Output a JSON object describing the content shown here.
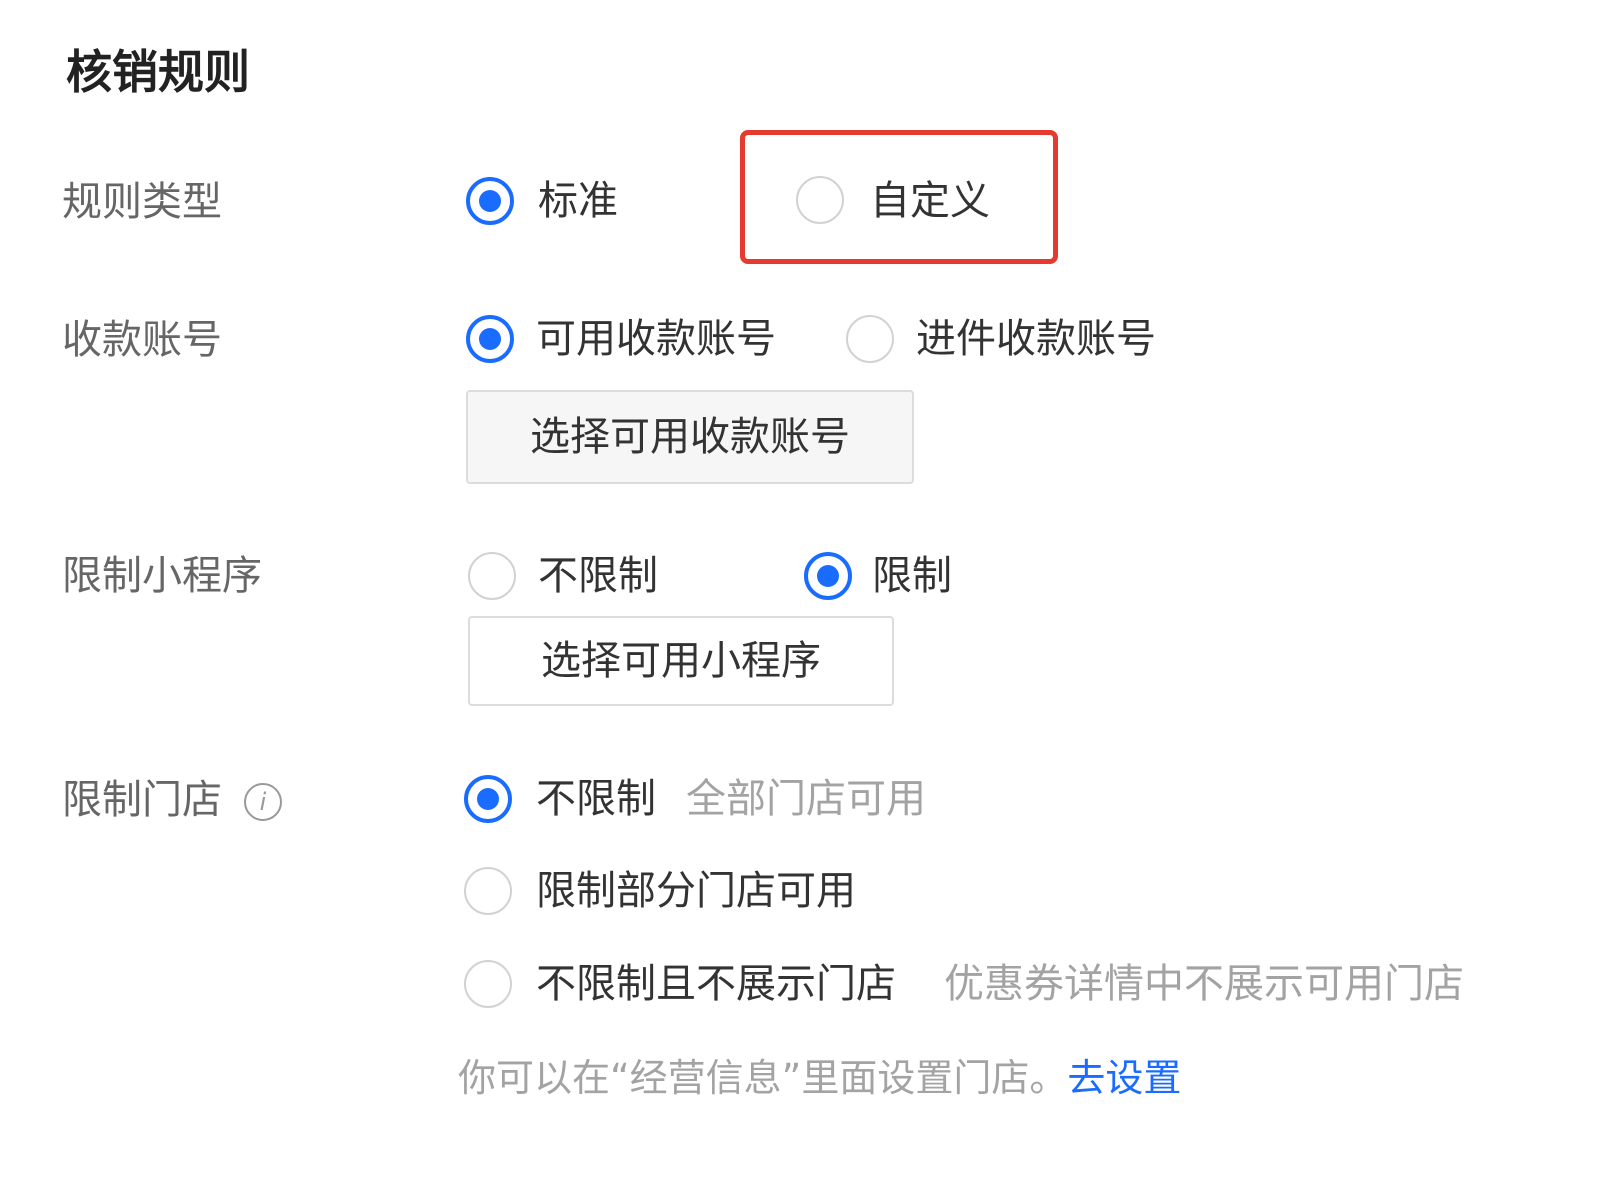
{
  "header": {
    "title": "核销规则"
  },
  "rule_type": {
    "label": "规则类型",
    "options": [
      {
        "label": "标准",
        "checked": true
      },
      {
        "label": "自定义",
        "checked": false
      }
    ]
  },
  "payment_account": {
    "label": "收款账号",
    "options": [
      {
        "label": "可用收款账号",
        "checked": true
      },
      {
        "label": "进件收款账号",
        "checked": false
      }
    ],
    "button_label": "选择可用收款账号"
  },
  "limit_miniprogram": {
    "label": "限制小程序",
    "options": [
      {
        "label": "不限制",
        "checked": false
      },
      {
        "label": "限制",
        "checked": true
      }
    ],
    "button_label": "选择可用小程序"
  },
  "limit_store": {
    "label": "限制门店",
    "info_icon": "info-icon",
    "options": [
      {
        "label": "不限制",
        "hint": "全部门店可用",
        "checked": true
      },
      {
        "label": "限制部分门店可用",
        "hint": "",
        "checked": false
      },
      {
        "label": "不限制且不展示门店",
        "hint": "优惠券详情中不展示可用门店",
        "checked": false
      }
    ],
    "note": "你可以在“经营信息”里面设置门店。",
    "note_link": "去设置"
  },
  "colors": {
    "accent": "#1a6cff",
    "highlight_border": "#e43a2f"
  }
}
